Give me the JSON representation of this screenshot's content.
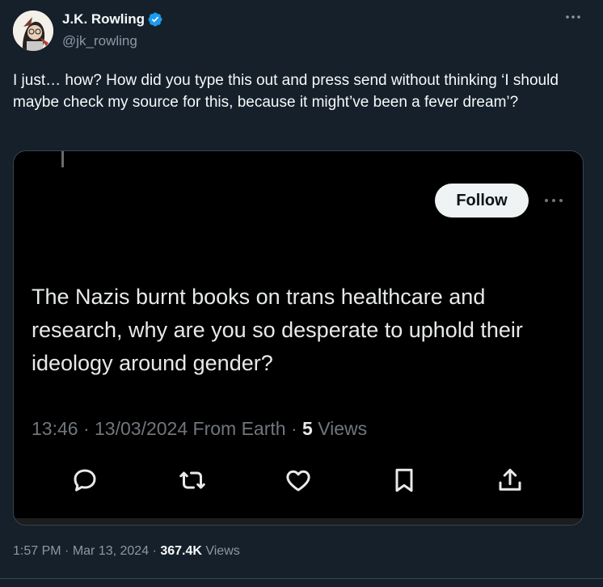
{
  "author": {
    "name": "J.K. Rowling",
    "handle": "@jk_rowling",
    "verified_color": "#1d9bf0",
    "avatar_icon": "avatar-illustration"
  },
  "tweet": {
    "text": "I just… how? How did you type this out and press send without thinking ‘I should maybe check my source for this, because it might’ve been a fever dream’?"
  },
  "screenshot": {
    "follow_label": "Follow",
    "quote_text": "The Nazis burnt books on trans healthcare and research, why are you so desperate to uphold their ideology around gender?",
    "time": "13:46",
    "sep1": " · ",
    "date": "13/03/2024",
    "location": " From Earth",
    "sep2": " · ",
    "views_count": "5",
    "views_label": " Views",
    "actions": [
      "reply-icon",
      "retweet-icon",
      "like-icon",
      "bookmark-icon",
      "share-icon"
    ]
  },
  "footer": {
    "time": "1:57 PM",
    "sep1": " · ",
    "date": "Mar 13, 2024",
    "sep2": " · ",
    "views_count": "367.4K",
    "views_label": " Views"
  },
  "colors": {
    "background": "#15202b",
    "text_primary": "#f7f9f9",
    "text_secondary": "#8b98a5",
    "border": "#38444d",
    "media_bg": "#000000"
  }
}
